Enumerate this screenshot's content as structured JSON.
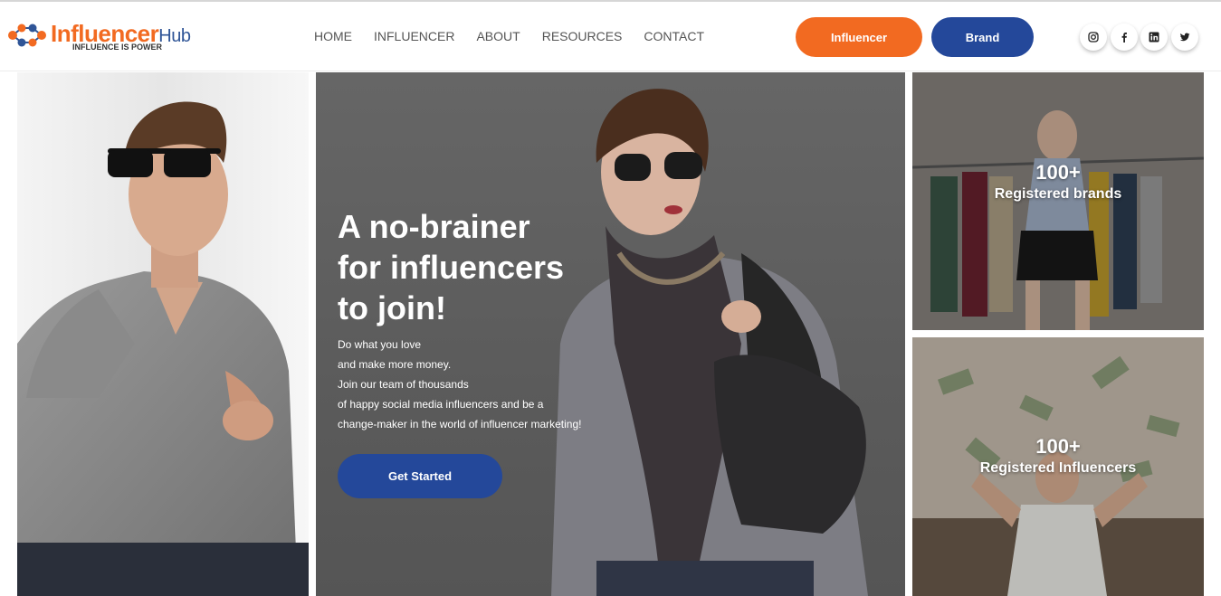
{
  "brand": {
    "name_main": "Influencer",
    "name_suffix": "Hub",
    "tagline": "INFLUENCE IS POWER",
    "colors": {
      "orange": "#f26a21",
      "blue": "#24489a"
    }
  },
  "nav": {
    "items": [
      {
        "label": "HOME"
      },
      {
        "label": "INFLUENCER"
      },
      {
        "label": "ABOUT"
      },
      {
        "label": "RESOURCES"
      },
      {
        "label": "CONTACT"
      }
    ]
  },
  "header_buttons": {
    "influencer_label": "Influencer",
    "brand_label": "Brand"
  },
  "social": [
    "instagram-icon",
    "facebook-icon",
    "linkedin-icon",
    "twitter-icon"
  ],
  "hero": {
    "title_lines": [
      "A no-brainer",
      "for influencers",
      "to join!"
    ],
    "body_lines": [
      "Do what you love",
      "and make more money.",
      "Join our team of thousands",
      "of happy social media influencers and be a",
      "change-maker in the world of influencer marketing!"
    ],
    "cta_label": "Get Started"
  },
  "stats": {
    "brands": {
      "count": "100+",
      "label": "Registered brands"
    },
    "influencers": {
      "count": "100+",
      "label": "Registered Influencers"
    }
  }
}
